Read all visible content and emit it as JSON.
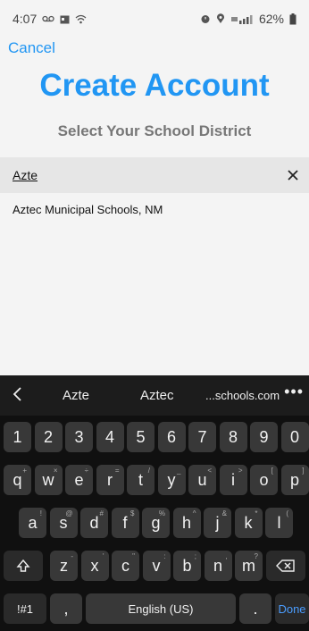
{
  "status": {
    "time": "4:07",
    "battery": "62%",
    "left_icons": [
      "voicemail-icon",
      "calendar-icon",
      "wifi-icon"
    ],
    "right_icons": [
      "alarm-icon",
      "location-icon",
      "signal-icon"
    ]
  },
  "header": {
    "cancel": "Cancel",
    "title": "Create Account",
    "subtitle": "Select Your School District"
  },
  "search": {
    "value": "Azte"
  },
  "results": [
    {
      "label": "Aztec Municipal Schools, NM"
    }
  ],
  "keyboard": {
    "suggestions": [
      "Azte",
      "Aztec",
      "...schools.com"
    ],
    "more": "•••",
    "row_numbers": [
      "1",
      "2",
      "3",
      "4",
      "5",
      "6",
      "7",
      "8",
      "9",
      "0"
    ],
    "row1": [
      {
        "k": "q",
        "h": "+"
      },
      {
        "k": "w",
        "h": "×"
      },
      {
        "k": "e",
        "h": "÷"
      },
      {
        "k": "r",
        "h": "="
      },
      {
        "k": "t",
        "h": "/"
      },
      {
        "k": "y",
        "h": "_"
      },
      {
        "k": "u",
        "h": "<"
      },
      {
        "k": "i",
        "h": ">"
      },
      {
        "k": "o",
        "h": "["
      },
      {
        "k": "p",
        "h": "]"
      }
    ],
    "row2": [
      {
        "k": "a",
        "h": "!"
      },
      {
        "k": "s",
        "h": "@"
      },
      {
        "k": "d",
        "h": "#"
      },
      {
        "k": "f",
        "h": "$"
      },
      {
        "k": "g",
        "h": "%"
      },
      {
        "k": "h",
        "h": "^"
      },
      {
        "k": "j",
        "h": "&"
      },
      {
        "k": "k",
        "h": "*"
      },
      {
        "k": "l",
        "h": "("
      }
    ],
    "row3": [
      {
        "k": "z",
        "h": "-"
      },
      {
        "k": "x",
        "h": "'"
      },
      {
        "k": "c",
        "h": "\""
      },
      {
        "k": "v",
        "h": ":"
      },
      {
        "k": "b",
        "h": ";"
      },
      {
        "k": "n",
        "h": ","
      },
      {
        "k": "m",
        "h": "?"
      }
    ],
    "symbols": "!#1",
    "comma": ",",
    "space": "English (US)",
    "period": ".",
    "done": "Done"
  }
}
